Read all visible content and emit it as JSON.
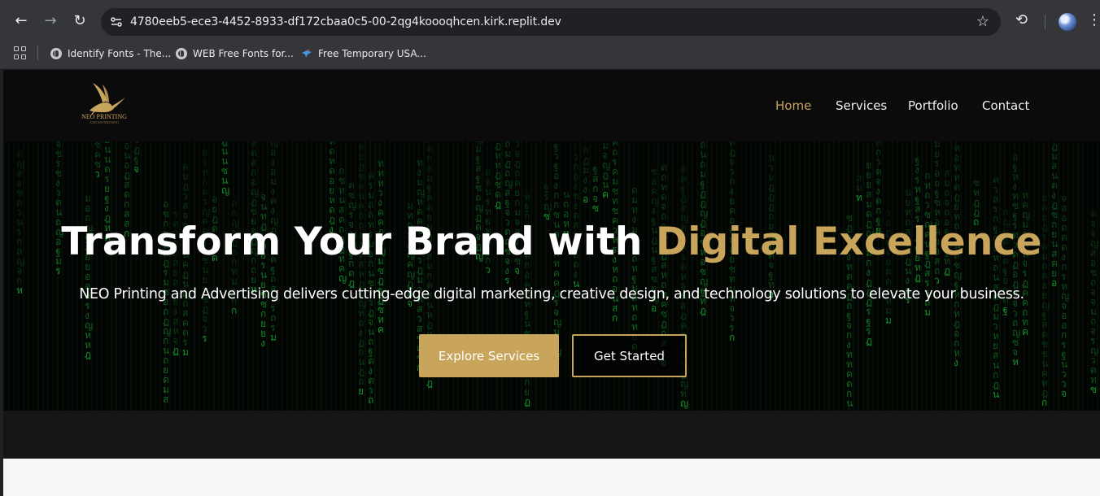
{
  "browser": {
    "url": "4780eeb5-ece3-4452-8933-df172cbaa0c5-00-2qg4koooqhcen.kirk.replit.dev",
    "bookmarks": [
      {
        "label": "Identify Fonts - The..."
      },
      {
        "label": "WEB Free Fonts for..."
      },
      {
        "label": "Free Temporary USA..."
      }
    ]
  },
  "site": {
    "logo_text": "NEO PRINTING",
    "logo_subtext": "AND ADVERTISING",
    "nav": {
      "home": "Home",
      "services": "Services",
      "portfolio": "Portfolio",
      "contact": "Contact"
    },
    "hero": {
      "title_main": "Transform Your Brand with ",
      "title_highlight": "Digital Excellence",
      "subtitle": "NEO Printing and Advertising delivers cutting-edge digital marketing, creative design, and technology solutions to elevate your business.",
      "primary_button": "Explore Services",
      "secondary_button": "Get Started"
    }
  },
  "colors": {
    "gold": "#c9a55c",
    "matrix_green": "#19c23a",
    "header_bg": "#0b0b0b"
  }
}
